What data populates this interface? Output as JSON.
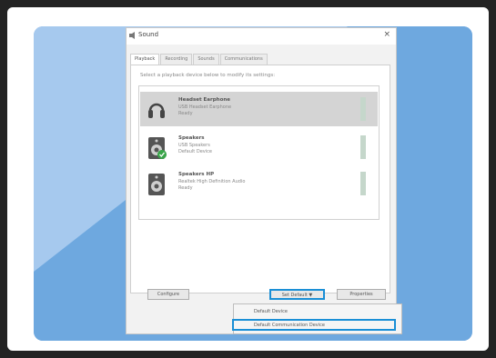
{
  "dialog": {
    "title": "Sound",
    "close_glyph": "×",
    "tabs": [
      {
        "label": "Playback"
      },
      {
        "label": "Recording"
      },
      {
        "label": "Sounds"
      },
      {
        "label": "Communications"
      }
    ],
    "instruction": "Select a playback device below to modify its settings:",
    "devices": [
      {
        "name": "Headset Earphone",
        "description": "USB Headset Earphone",
        "status": "Ready",
        "icon": "headset-icon"
      },
      {
        "name": "Speakers",
        "description": "USB Speakers",
        "status": "Default Device",
        "icon": "speaker-icon"
      },
      {
        "name": "Speakers HP",
        "description": "Realtek High Definition Audio",
        "status": "Ready",
        "icon": "speaker-icon"
      }
    ],
    "buttons": {
      "configure": "Configure",
      "set_default": "Set Default ▼",
      "properties": "Properties"
    },
    "dropdown": {
      "items": [
        "Default Device",
        "Default Communication Device"
      ]
    }
  },
  "colors": {
    "accent": "#1a8fd6",
    "panel_blue": "#7db3e6",
    "default_check": "#3aa54a"
  }
}
